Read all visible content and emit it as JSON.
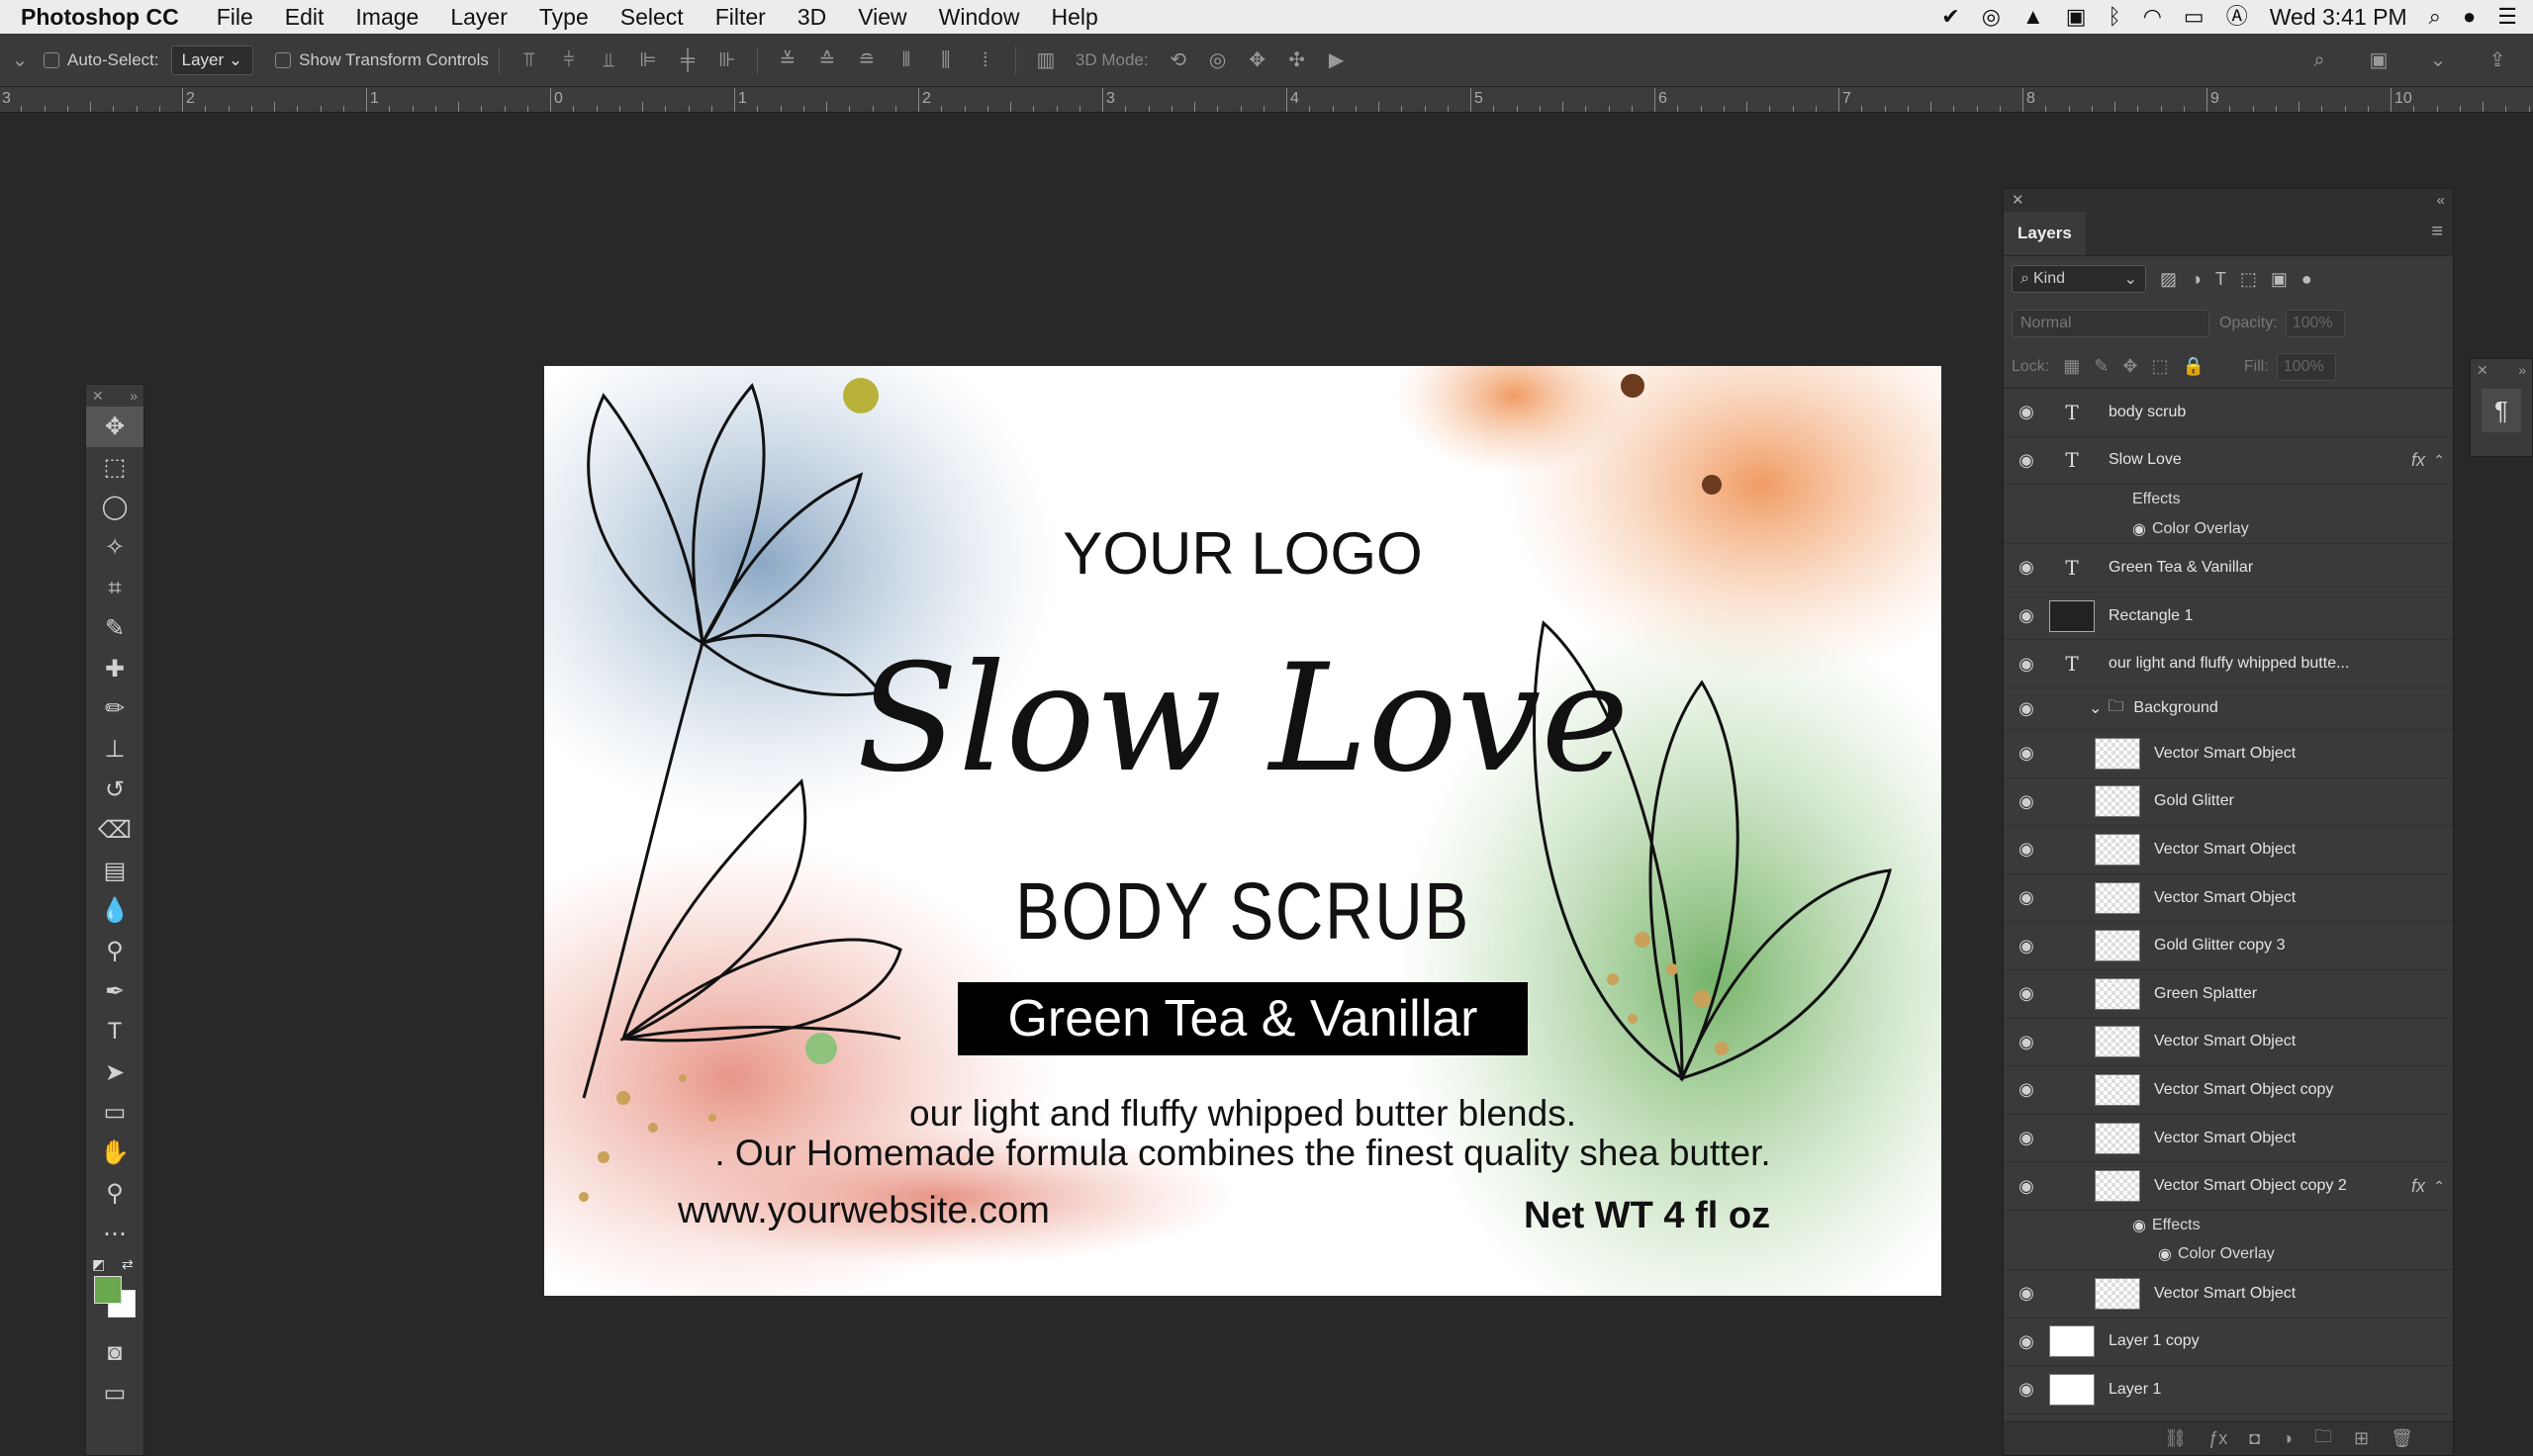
{
  "menubar": {
    "app_name": "Photoshop CC",
    "items": [
      "File",
      "Edit",
      "Image",
      "Layer",
      "Type",
      "Select",
      "Filter",
      "3D",
      "View",
      "Window",
      "Help"
    ],
    "clock": "Wed 3:41 PM"
  },
  "options_bar": {
    "auto_select_label": "Auto-Select:",
    "auto_select_value": "Layer",
    "transform_label": "Show Transform Controls",
    "mode_label": "3D Mode:"
  },
  "ruler": {
    "labels": [
      "3",
      "2",
      "1",
      "0",
      "1",
      "2",
      "3",
      "4",
      "5",
      "6",
      "7",
      "8",
      "9",
      "10"
    ]
  },
  "canvas": {
    "logo": "YOUR LOGO",
    "script_title": "Slow Love",
    "subtitle": "BODY SCRUB",
    "flavor": "Green Tea & Vanillar",
    "desc_line1": "our light and fluffy whipped butter blends.",
    "desc_line2": ". Our Homemade formula combines the finest quality shea butter.",
    "website": "www.yourwebsite.com",
    "net_weight": "Net WT 4 fl oz"
  },
  "layers_panel": {
    "tab_label": "Layers",
    "kind_label": "Kind",
    "blend_mode": "Normal",
    "opacity_label": "Opacity:",
    "opacity_value": "100%",
    "lock_label": "Lock:",
    "fill_label": "Fill:",
    "fill_value": "100%",
    "layers": [
      {
        "name": "body scrub",
        "type": "text"
      },
      {
        "name": "Slow Love",
        "type": "text",
        "fx": "fx"
      },
      {
        "name": "Effects",
        "type": "effects"
      },
      {
        "name": "Color Overlay",
        "type": "effect-item"
      },
      {
        "name": "Green Tea & Vanillar",
        "type": "text"
      },
      {
        "name": "Rectangle 1",
        "type": "shape"
      },
      {
        "name": "our light and fluffy whipped butte...",
        "type": "text"
      },
      {
        "name": "Background",
        "type": "group"
      },
      {
        "name": "Vector Smart Object",
        "type": "smart"
      },
      {
        "name": "Gold Glitter",
        "type": "smart"
      },
      {
        "name": "Vector Smart Object",
        "type": "smart"
      },
      {
        "name": "Vector Smart Object",
        "type": "smart"
      },
      {
        "name": "Gold Glitter copy 3",
        "type": "smart"
      },
      {
        "name": "Green Splatter",
        "type": "smart"
      },
      {
        "name": "Vector Smart Object",
        "type": "smart"
      },
      {
        "name": "Vector Smart Object copy",
        "type": "smart"
      },
      {
        "name": "Vector Smart Object",
        "type": "smart"
      },
      {
        "name": "Vector Smart Object copy 2",
        "type": "smart",
        "fx": "fx"
      },
      {
        "name": "Effects",
        "type": "effects2"
      },
      {
        "name": "Color Overlay",
        "type": "effect-item2"
      },
      {
        "name": "Vector Smart Object",
        "type": "smart"
      },
      {
        "name": "Layer 1 copy",
        "type": "pixel"
      },
      {
        "name": "Layer 1",
        "type": "pixel"
      }
    ]
  },
  "colors": {
    "foreground": "#6aa84f",
    "background": "#ffffff",
    "panel": "#3a3a3a"
  }
}
